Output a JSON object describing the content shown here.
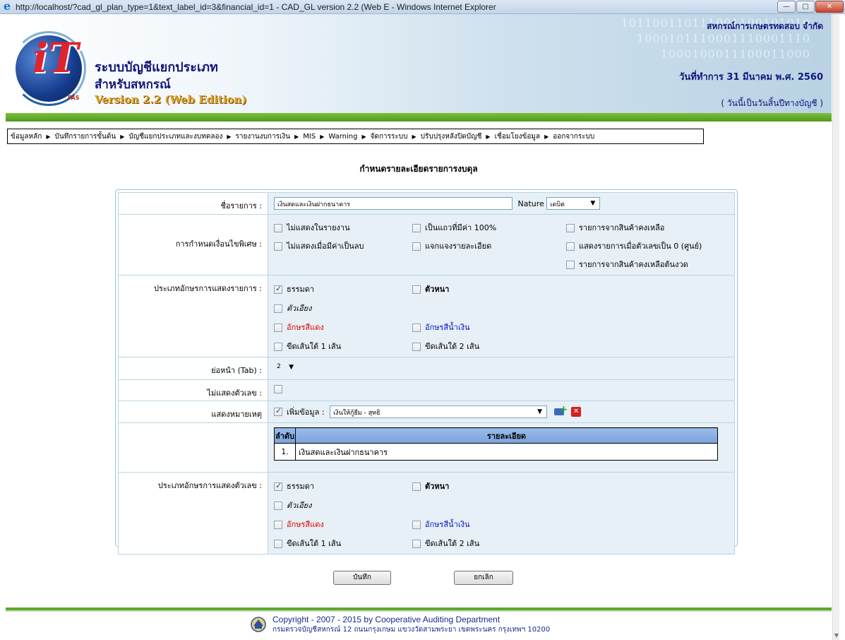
{
  "window": {
    "title": "http://localhost/?cad_gl_plan_type=1&text_label_id=3&financial_id=1 - CAD_GL version 2.2 (Web E - Windows Internet Explorer",
    "min": "—",
    "max": "▢",
    "close": "✕"
  },
  "header": {
    "app_name_line1": "ระบบบัญชีแยกประเภท",
    "app_name_line2": "สำหรับสหกรณ์",
    "version": "Version 2.2 (Web Edition)",
    "logo_text": "iT",
    "logo_subtext": "FAS",
    "binary_1": "101100110111001100101010",
    "binary_2": "1000101110001110001110",
    "binary_3": "1000100011100011000",
    "org_name": "สหกรณ์การเกษตรทดสอบ จำกัด",
    "work_date": "วันที่ทำการ 31 มีนาคม พ.ศ. 2560",
    "fy_note": "( วันนี้เป็นวันสิ้นปีทางบัญชี )"
  },
  "menu": {
    "items": [
      "ข้อมูลหลัก",
      "บันทึกรายการขั้นต้น",
      "บัญชีแยกประเภทและงบทดลอง",
      "รายงานงบการเงิน",
      "MIS",
      "Warning",
      "จัดการระบบ",
      "ปรับปรุงหลังปิดบัญชี",
      "เชื่อมโยงข้อมูล",
      "ออกจากระบบ"
    ],
    "separator": "▶"
  },
  "page_title": "กำหนดรายละเอียดรายการงบดุล",
  "form": {
    "item_name": {
      "label": "ชื่อรายการ :",
      "value": "เงินสดและเงินฝากธนาคาร"
    },
    "nature": {
      "label": "Nature",
      "value": "เดบิต"
    },
    "special": {
      "label": "การกำหนดเงื่อนไขพิเศษ :",
      "options": [
        "ไม่แสดงในรายงาน",
        "เป็นแถวที่มีค่า 100%",
        "รายการจากสินค้าคงเหลือ",
        "ไม่แสดงเมื่อมีค่าเป็นลบ",
        "แจกแจงรายละเอียด",
        "แสดงรายการเมื่อตัวเลขเป็น 0 (ศูนย์)",
        "รายการจากสินค้าคงเหลือต้นงวด"
      ]
    },
    "item_font": {
      "label": "ประเภทอักษรการแสดงรายการ :",
      "normal": "ธรรมดา",
      "bold": "ตัวหนา",
      "italic": "ตัวเอียง",
      "red": "อักษรสีแดง",
      "blue": "อักษรสีน้ำเงิน",
      "underline1": "ขีดเส้นใต้ 1 เส้น",
      "underline2": "ขีดเส้นใต้ 2 เส้น"
    },
    "indent": {
      "label": "ย่อหน้า (Tab) :",
      "value": "2"
    },
    "hide_number": {
      "label": "ไม่แสดงตัวเลข :"
    },
    "note": {
      "label": "แสดงหมายเหตุ",
      "add_label": "เพิ่มข้อมูล :",
      "value": "เงินให้กู้ยืม - สุทธิ"
    },
    "note_table": {
      "headers": [
        "ลำดับ",
        "รายละเอียด"
      ],
      "rows": [
        {
          "no": "1.",
          "detail": "เงินสดและเงินฝากธนาคาร"
        }
      ]
    },
    "number_font": {
      "label": "ประเภทอักษรการแสดงตัวเลข :",
      "normal": "ธรรมดา",
      "bold": "ตัวหนา",
      "italic": "ตัวเอียง",
      "red": "อักษรสีแดง",
      "blue": "อักษรสีน้ำเงิน",
      "underline1": "ขีดเส้นใต้ 1 เส้น",
      "underline2": "ขีดเส้นใต้ 2 เส้น"
    }
  },
  "buttons": {
    "save": "บันทึก",
    "cancel": "ยกเลิก"
  },
  "footer": {
    "copyright": "Copyright - 2007 - 2015 by Cooperative Auditing Department",
    "address": "กรมตรวจบัญชีสหกรณ์ 12 ถนนกรุงเกษม แขวงวัดสามพระยา เขตพระนคร กรุงเทพฯ 10200"
  },
  "colors": {
    "accent_green": "#4e9a1e",
    "header_navy": "#10167a",
    "table_header": "#7aa2dc"
  }
}
